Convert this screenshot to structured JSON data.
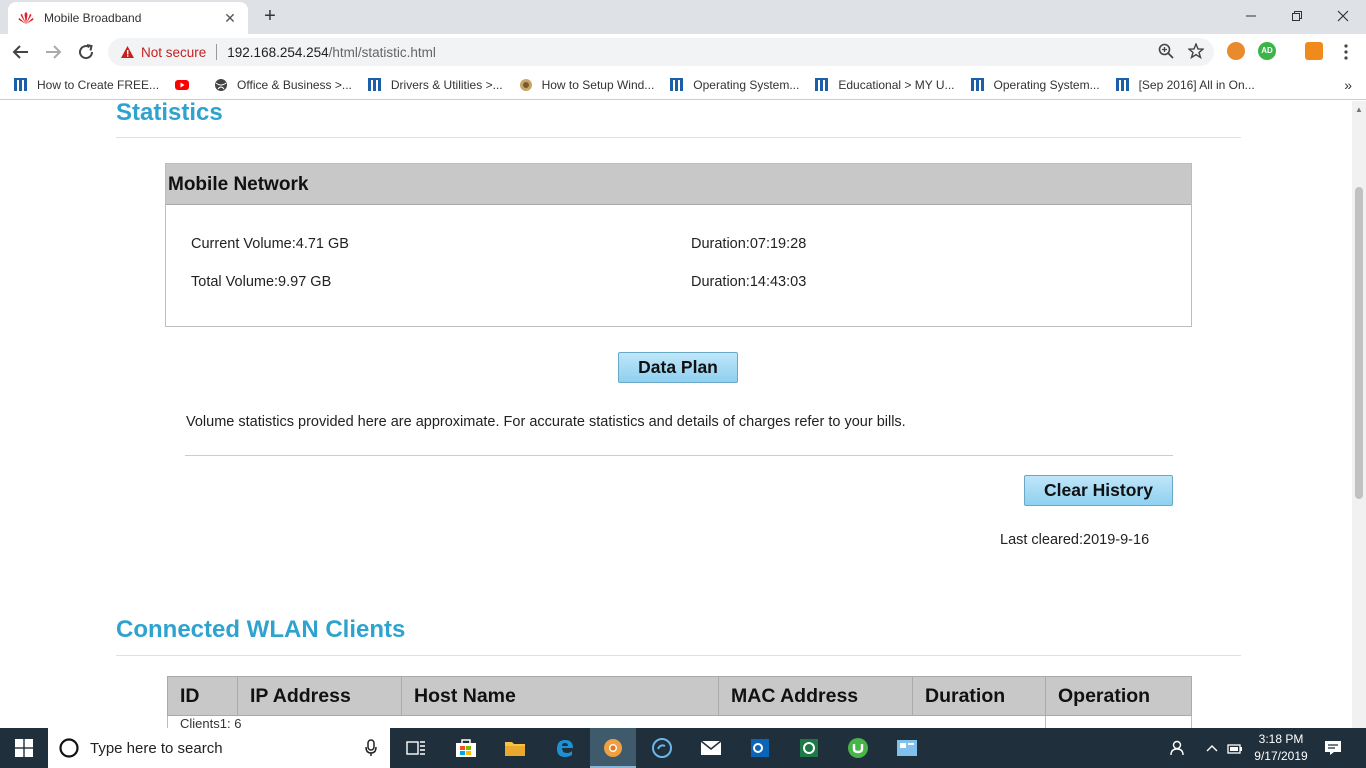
{
  "browser": {
    "tab_title": "Mobile Broadband",
    "security_label": "Not secure",
    "url_host": "192.168.254.254",
    "url_path": "/html/statistic.html",
    "bookmarks": [
      "How to Create FREE...",
      "",
      "Office & Business >...",
      "Drivers & Utilities >...",
      "How to Setup Wind...",
      "Operating System...",
      "Educational > MY U...",
      "Operating System...",
      "[Sep 2016] All in On..."
    ],
    "extension_badge": "AD"
  },
  "statistics": {
    "title": "Statistics",
    "mobile_network": {
      "heading": "Mobile Network",
      "current_volume": "Current Volume:4.71 GB",
      "current_duration": "Duration:07:19:28",
      "total_volume": "Total Volume:9.97 GB",
      "total_duration": "Duration:14:43:03"
    },
    "data_plan_button": "Data Plan",
    "note": "Volume statistics provided here are approximate. For accurate statistics and details of charges refer to your bills.",
    "clear_history_button": "Clear History",
    "last_cleared": "Last cleared:2019-9-16"
  },
  "wlan": {
    "title": "Connected WLAN Clients",
    "columns": [
      "ID",
      "IP Address",
      "Host Name",
      "MAC Address",
      "Duration",
      "Operation"
    ],
    "first_row_partial": "Clients1: 6"
  },
  "taskbar": {
    "search_placeholder": "Type here to search",
    "time": "3:18 PM",
    "date": "9/17/2019"
  },
  "colors": {
    "section_title": "#2ea3cf",
    "button_gradient_top": "#bfe6f9",
    "button_gradient_bottom": "#8fd0f1",
    "table_header": "#c8c8c8",
    "taskbar": "#1f2f3b",
    "warning": "#c5221f"
  }
}
